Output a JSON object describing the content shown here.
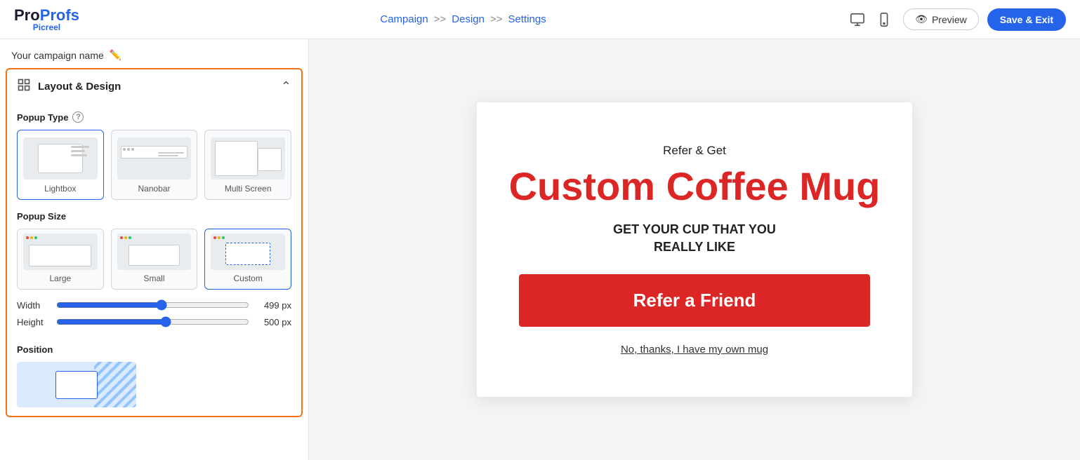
{
  "header": {
    "logo_pro": "Pro",
    "logo_profs": "Profs",
    "logo_picreel": "Picreel",
    "nav": {
      "campaign": "Campaign",
      "arrow1": ">>",
      "design": "Design",
      "arrow2": ">>",
      "settings": "Settings"
    },
    "preview_label": "Preview",
    "save_exit_label": "Save & Exit"
  },
  "sidebar": {
    "campaign_name": "Your campaign name",
    "section_title": "Layout & Design",
    "popup_type": {
      "label": "Popup Type",
      "options": [
        {
          "id": "lightbox",
          "label": "Lightbox",
          "selected": true
        },
        {
          "id": "nanobar",
          "label": "Nanobar",
          "selected": false
        },
        {
          "id": "multiscreen",
          "label": "Multi Screen",
          "selected": false
        }
      ]
    },
    "popup_size": {
      "label": "Popup Size",
      "options": [
        {
          "id": "large",
          "label": "Large",
          "selected": false
        },
        {
          "id": "small",
          "label": "Small",
          "selected": false
        },
        {
          "id": "custom",
          "label": "Custom",
          "selected": true
        }
      ],
      "width_label": "Width",
      "width_value": "499 px",
      "width_percent": 55,
      "height_label": "Height",
      "height_value": "500 px",
      "height_percent": 57
    },
    "position": {
      "label": "Position"
    }
  },
  "preview": {
    "refer_text": "Refer & Get",
    "title": "Custom Coffee Mug",
    "subtitle_line1": "GET YOUR CUP THAT YOU",
    "subtitle_line2": "REALLY LIKE",
    "button_label": "Refer a Friend",
    "decline_label": "No, thanks, I have my own mug"
  }
}
